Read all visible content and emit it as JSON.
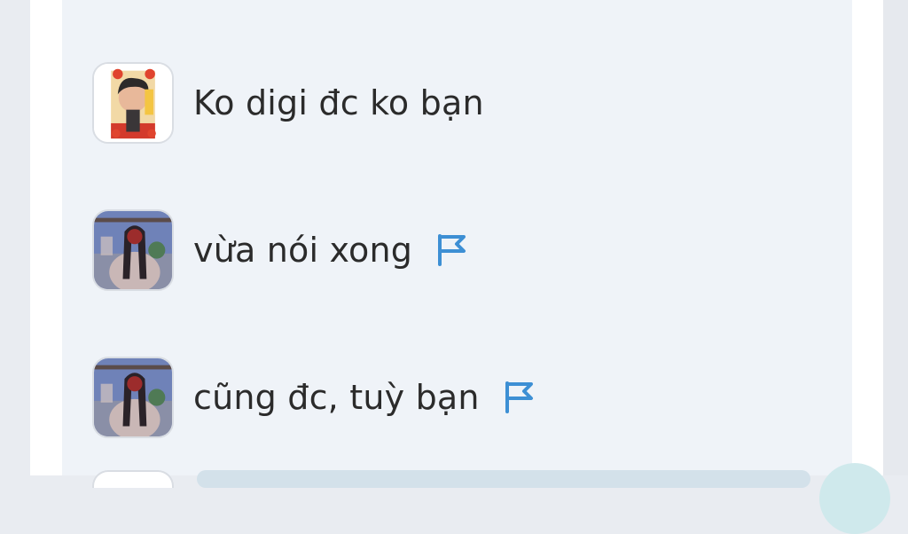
{
  "messages": [
    {
      "text": "Ko digi đc ko bạn",
      "avatar": "user-avatar-boy",
      "flag": false
    },
    {
      "text": "vừa nói xong",
      "avatar": "user-avatar-girl",
      "flag": true
    },
    {
      "text": "cũng đc, tuỳ bạn",
      "avatar": "user-avatar-girl",
      "flag": true
    }
  ],
  "colors": {
    "panel": "#eff3f8",
    "flag": "#3d8fd4",
    "text": "#2b2b2b"
  }
}
